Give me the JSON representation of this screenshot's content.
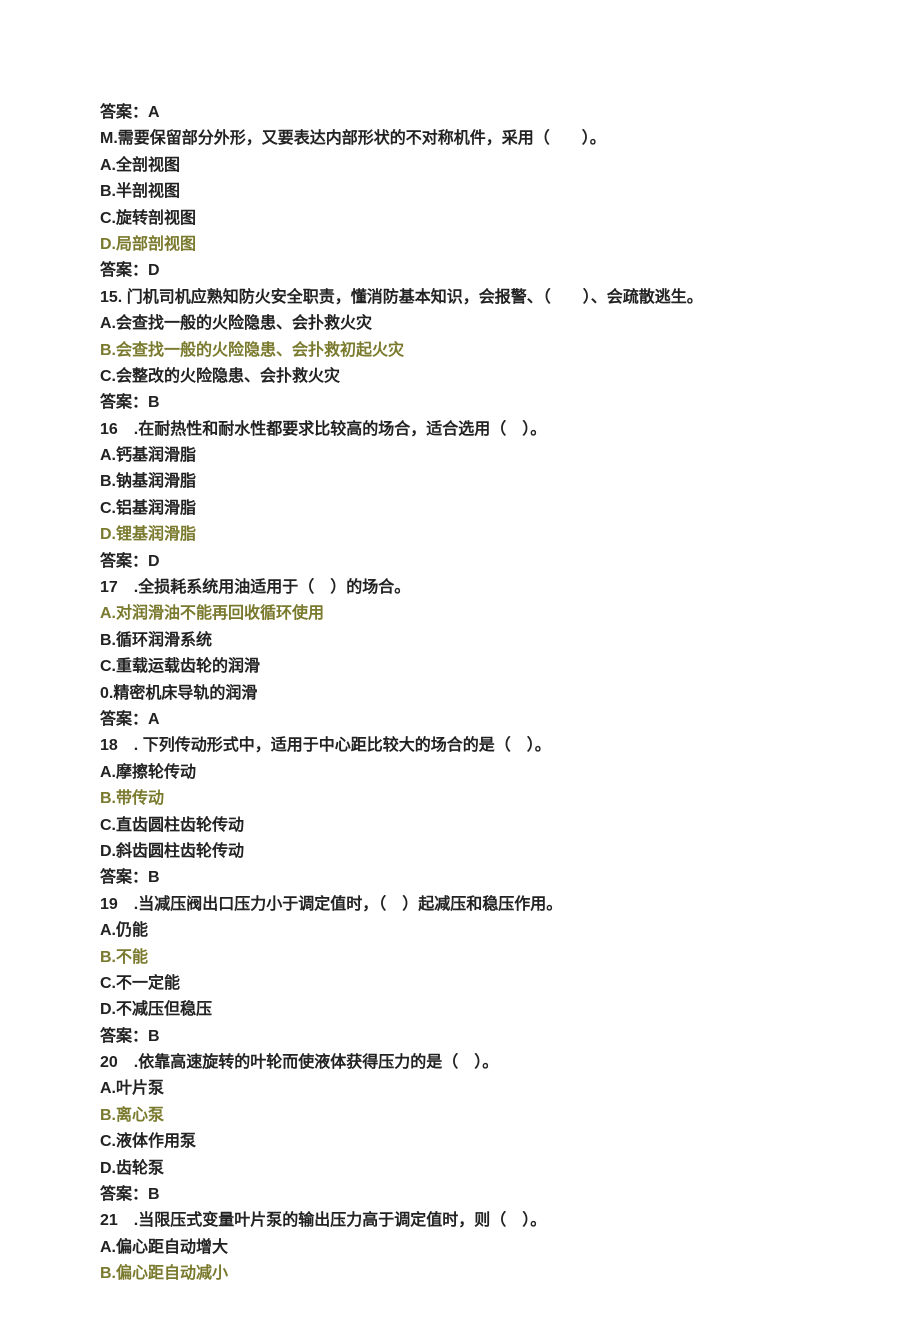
{
  "ans13": "答案：A",
  "q14_stem": "M.需要保留部分外形，又要表达内部形状的不对称机件，采用（　　）。",
  "q14_A": "A.全剖视图",
  "q14_B": "B.半剖视图",
  "q14_C": "C.旋转剖视图",
  "q14_D": "D.局部剖视图",
  "ans14": "答案：D",
  "q15_stem": "15. 门机司机应熟知防火安全职责，懂消防基本知识，会报警、（　　）、会疏散逃生。",
  "q15_A": "A.会查找一般的火险隐患、会扑救火灾",
  "q15_B": "B.会查找一般的火险隐患、会扑救初起火灾",
  "q15_C": "C.会整改的火险隐患、会扑救火灾",
  "ans15": "答案：B",
  "q16_stem": "16　.在耐热性和耐水性都要求比较高的场合，适合选用（　）。",
  "q16_A": "A.钙基润滑脂",
  "q16_B": "B.钠基润滑脂",
  "q16_C": "C.铝基润滑脂",
  "q16_D": "D.锂基润滑脂",
  "ans16": "答案：D",
  "q17_stem": "17　.全损耗系统用油适用于（　）的场合。",
  "q17_A": "A.对润滑油不能再回收循环使用",
  "q17_B": "B.循环润滑系统",
  "q17_C": "C.重载运载齿轮的润滑",
  "q17_D": "0.精密机床导轨的润滑",
  "ans17": "答案：A",
  "q18_stem": "18　. 下列传动形式中，适用于中心距比较大的场合的是（　）。",
  "q18_A": "A.摩擦轮传动",
  "q18_B": "B.带传动",
  "q18_C": "C.直齿圆柱齿轮传动",
  "q18_D": "D.斜齿圆柱齿轮传动",
  "ans18": "答案：B",
  "q19_stem": "19　.当减压阀出口压力小于调定值时，（　）起减压和稳压作用。",
  "q19_A": "A.仍能",
  "q19_B": "B.不能",
  "q19_C": "C.不一定能",
  "q19_D": "D.不减压但稳压",
  "ans19": "答案：B",
  "q20_stem": "20　.依靠高速旋转的叶轮而使液体获得压力的是（　）。",
  "q20_A": "A.叶片泵",
  "q20_B": "B.离心泵",
  "q20_C": "C.液体作用泵",
  "q20_D": "D.齿轮泵",
  "ans20": "答案：B",
  "q21_stem": "21　.当限压式变量叶片泵的输出压力高于调定值时，则（　）。",
  "q21_A": "A.偏心距自动增大",
  "q21_B": "B.偏心距自动减小"
}
